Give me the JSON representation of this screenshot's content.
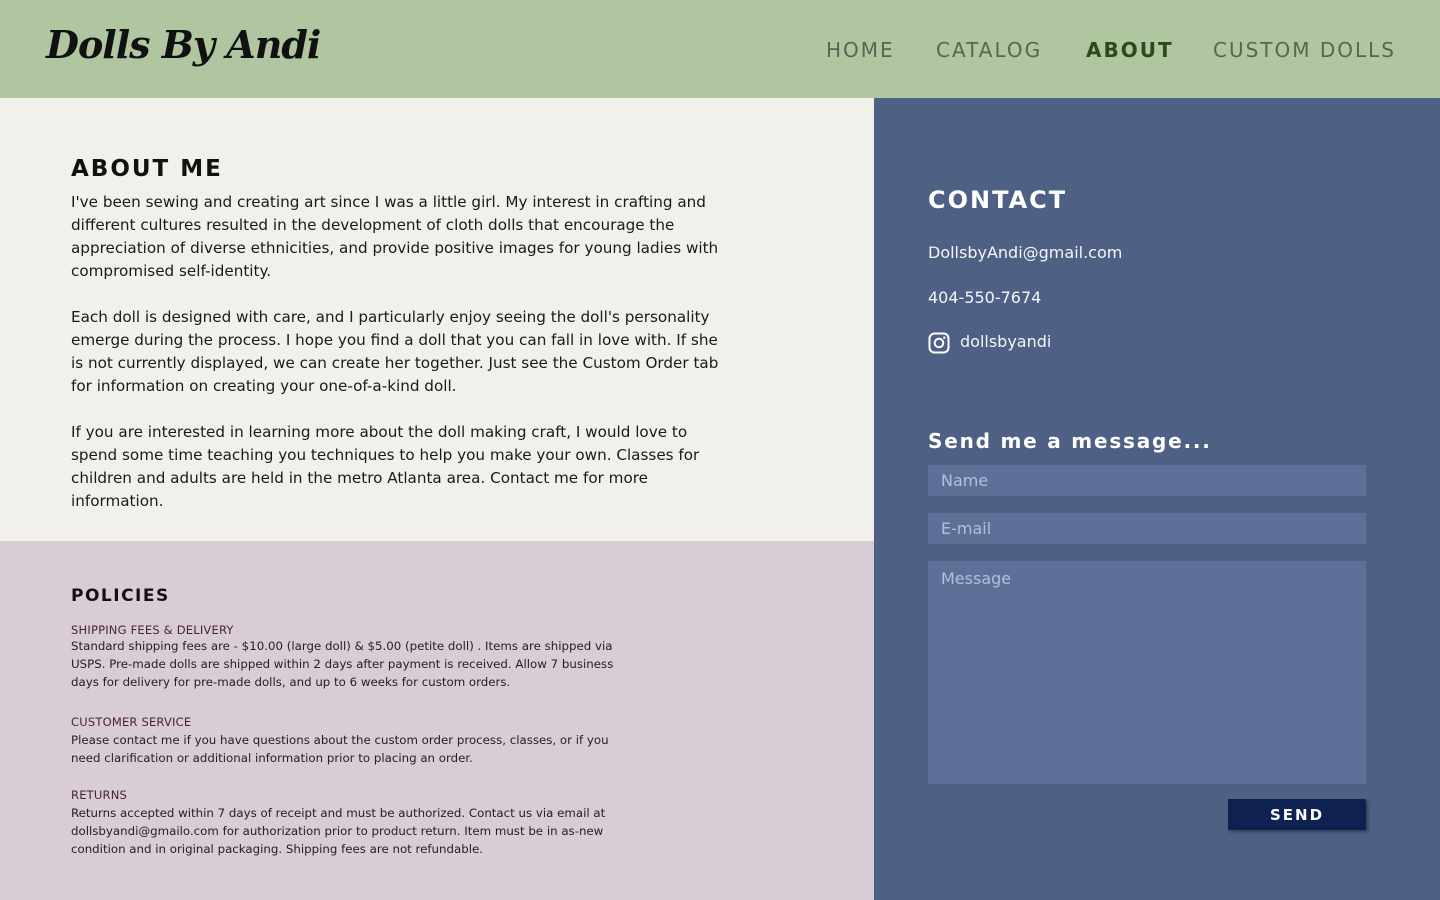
{
  "header": {
    "logo": "Dolls By Andi",
    "nav": [
      {
        "label": "HOME",
        "active": false
      },
      {
        "label": "CATALOG",
        "active": false
      },
      {
        "label": "ABOUT",
        "active": true
      },
      {
        "label": "CUSTOM DOLLS",
        "active": false
      }
    ]
  },
  "about": {
    "title": "ABOUT ME",
    "paragraphs": [
      "I've been sewing and creating art since I was a little girl.  My interest in crafting and different cultures resulted in the development of cloth dolls that encourage the appreciation of diverse ethnicities, and provide positive images for young ladies with compromised self-identity.",
      "Each doll is designed with care, and I particularly enjoy seeing the doll's personality emerge during the process.  I hope you find a doll that you can fall in love with.  If  she is not currently displayed, we can create her together.  Just see the Custom Order tab for information on creating your one-of-a-kind  doll.",
      "If you are interested in learning more about the doll making craft, I would love to spend some time teaching you techniques to help you make your own.   Classes for children and adults are held in the metro Atlanta area.  Contact me for more information."
    ]
  },
  "policies": {
    "title": "POLICIES",
    "sections": [
      {
        "heading": "SHIPPING FEES & DELIVERY",
        "text": "Standard shipping  fees are  - $10.00 (large doll) &  $5.00 (petite doll) .  Items are shipped via USPS.  Pre-made dolls are shipped within 2 days after  payment is received.  Allow 7 business days for delivery for pre-made dolls, and up to 6 weeks for custom orders."
      },
      {
        "heading": "CUSTOMER SERVICE",
        "text": "Please contact me if you have questions about the custom order process, classes, or if you need clarification or additional information prior to placing an order."
      },
      {
        "heading": "RETURNS",
        "text": "Returns accepted within 7 days of receipt and must be authorized.  Contact us via email at dollsbyandi@gmailo.com  for authorization prior to product return.  Item must be in as-new condition and in original packaging.  Shipping fees are not refundable."
      }
    ]
  },
  "contact": {
    "title": "CONTACT",
    "email": "DollsbyAndi@gmail.com",
    "phone": "404-550-7674",
    "instagram": "dollsbyandi",
    "instagram_icon": "instagram-icon",
    "form": {
      "title": "Send me a message...",
      "name_placeholder": "Name",
      "email_placeholder": "E-mail",
      "message_placeholder": "Message",
      "send_label": "SEND"
    }
  },
  "colors": {
    "header_bg": "#b0c6a1",
    "about_bg": "#f1f0ea",
    "policies_bg": "#d8cdd4",
    "contact_bg": "#4e6185",
    "field_bg": "#5e7097",
    "send_bg": "#0f2150",
    "nav_active": "#2d4a1c"
  }
}
